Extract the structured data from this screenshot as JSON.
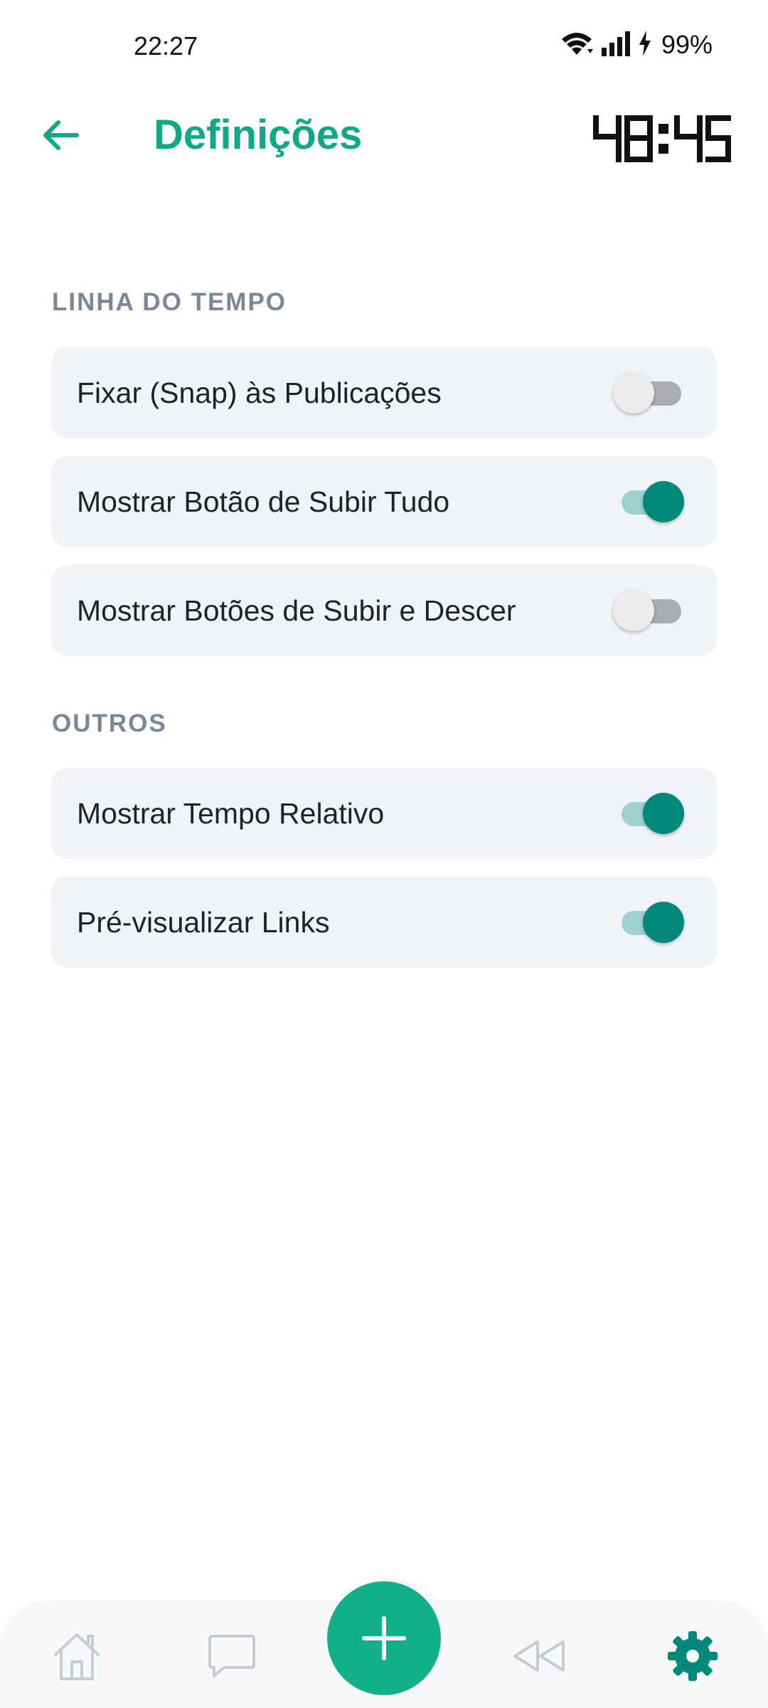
{
  "status_bar": {
    "time": "22:27",
    "battery": "99%"
  },
  "app_bar": {
    "title": "Definições",
    "timer": "48:45"
  },
  "sections": [
    {
      "label": "LINHA DO TEMPO",
      "items": [
        {
          "label": "Fixar (Snap) às Publicações",
          "enabled": false
        },
        {
          "label": "Mostrar Botão de Subir Tudo",
          "enabled": true
        },
        {
          "label": "Mostrar Botões de Subir e Descer",
          "enabled": false
        }
      ]
    },
    {
      "label": "OUTROS",
      "items": [
        {
          "label": "Mostrar Tempo Relativo",
          "enabled": true
        },
        {
          "label": "Pré-visualizar Links",
          "enabled": true
        }
      ]
    }
  ],
  "bottom_nav": {
    "items": [
      {
        "icon": "home-icon",
        "active": false
      },
      {
        "icon": "chat-bubble-icon",
        "active": false
      },
      {
        "icon": "add-icon",
        "active": false
      },
      {
        "icon": "rewind-icon",
        "active": false
      },
      {
        "icon": "gear-icon",
        "active": true
      }
    ]
  },
  "colors": {
    "accent": "#12a886",
    "toggle_on": "#00897b",
    "toggle_on_track": "#9fd2cd",
    "toggle_off_track": "#a9adb2",
    "row_background": "#f0f3f8",
    "section_label": "#7a8799",
    "nav_icon_inactive": "#c7ccd4"
  }
}
